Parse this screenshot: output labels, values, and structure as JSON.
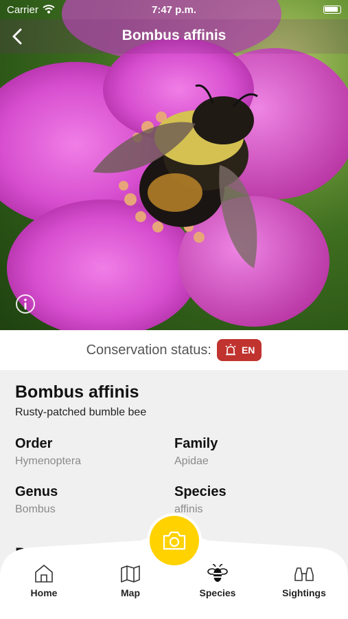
{
  "status_bar": {
    "carrier": "Carrier",
    "time": "7:47 p.m."
  },
  "header": {
    "title": "Bombus affinis"
  },
  "conservation": {
    "label": "Conservation status:",
    "badge": "EN",
    "badge_color": "#c0332f"
  },
  "species": {
    "scientific_name": "Bombus affinis",
    "common_name": "Rusty-patched bumble bee",
    "order_label": "Order",
    "order_value": "Hymenoptera",
    "family_label": "Family",
    "family_value": "Apidae",
    "genus_label": "Genus",
    "genus_value": "Bombus",
    "species_label": "Species",
    "species_value": "affinis",
    "partial_heading": "D"
  },
  "tabs": [
    {
      "label": "Home",
      "icon": "home-icon"
    },
    {
      "label": "Map",
      "icon": "map-icon"
    },
    {
      "label": "Species",
      "icon": "bee-icon"
    },
    {
      "label": "Sightings",
      "icon": "binoculars-icon"
    }
  ],
  "accent_color": "#ffd200"
}
